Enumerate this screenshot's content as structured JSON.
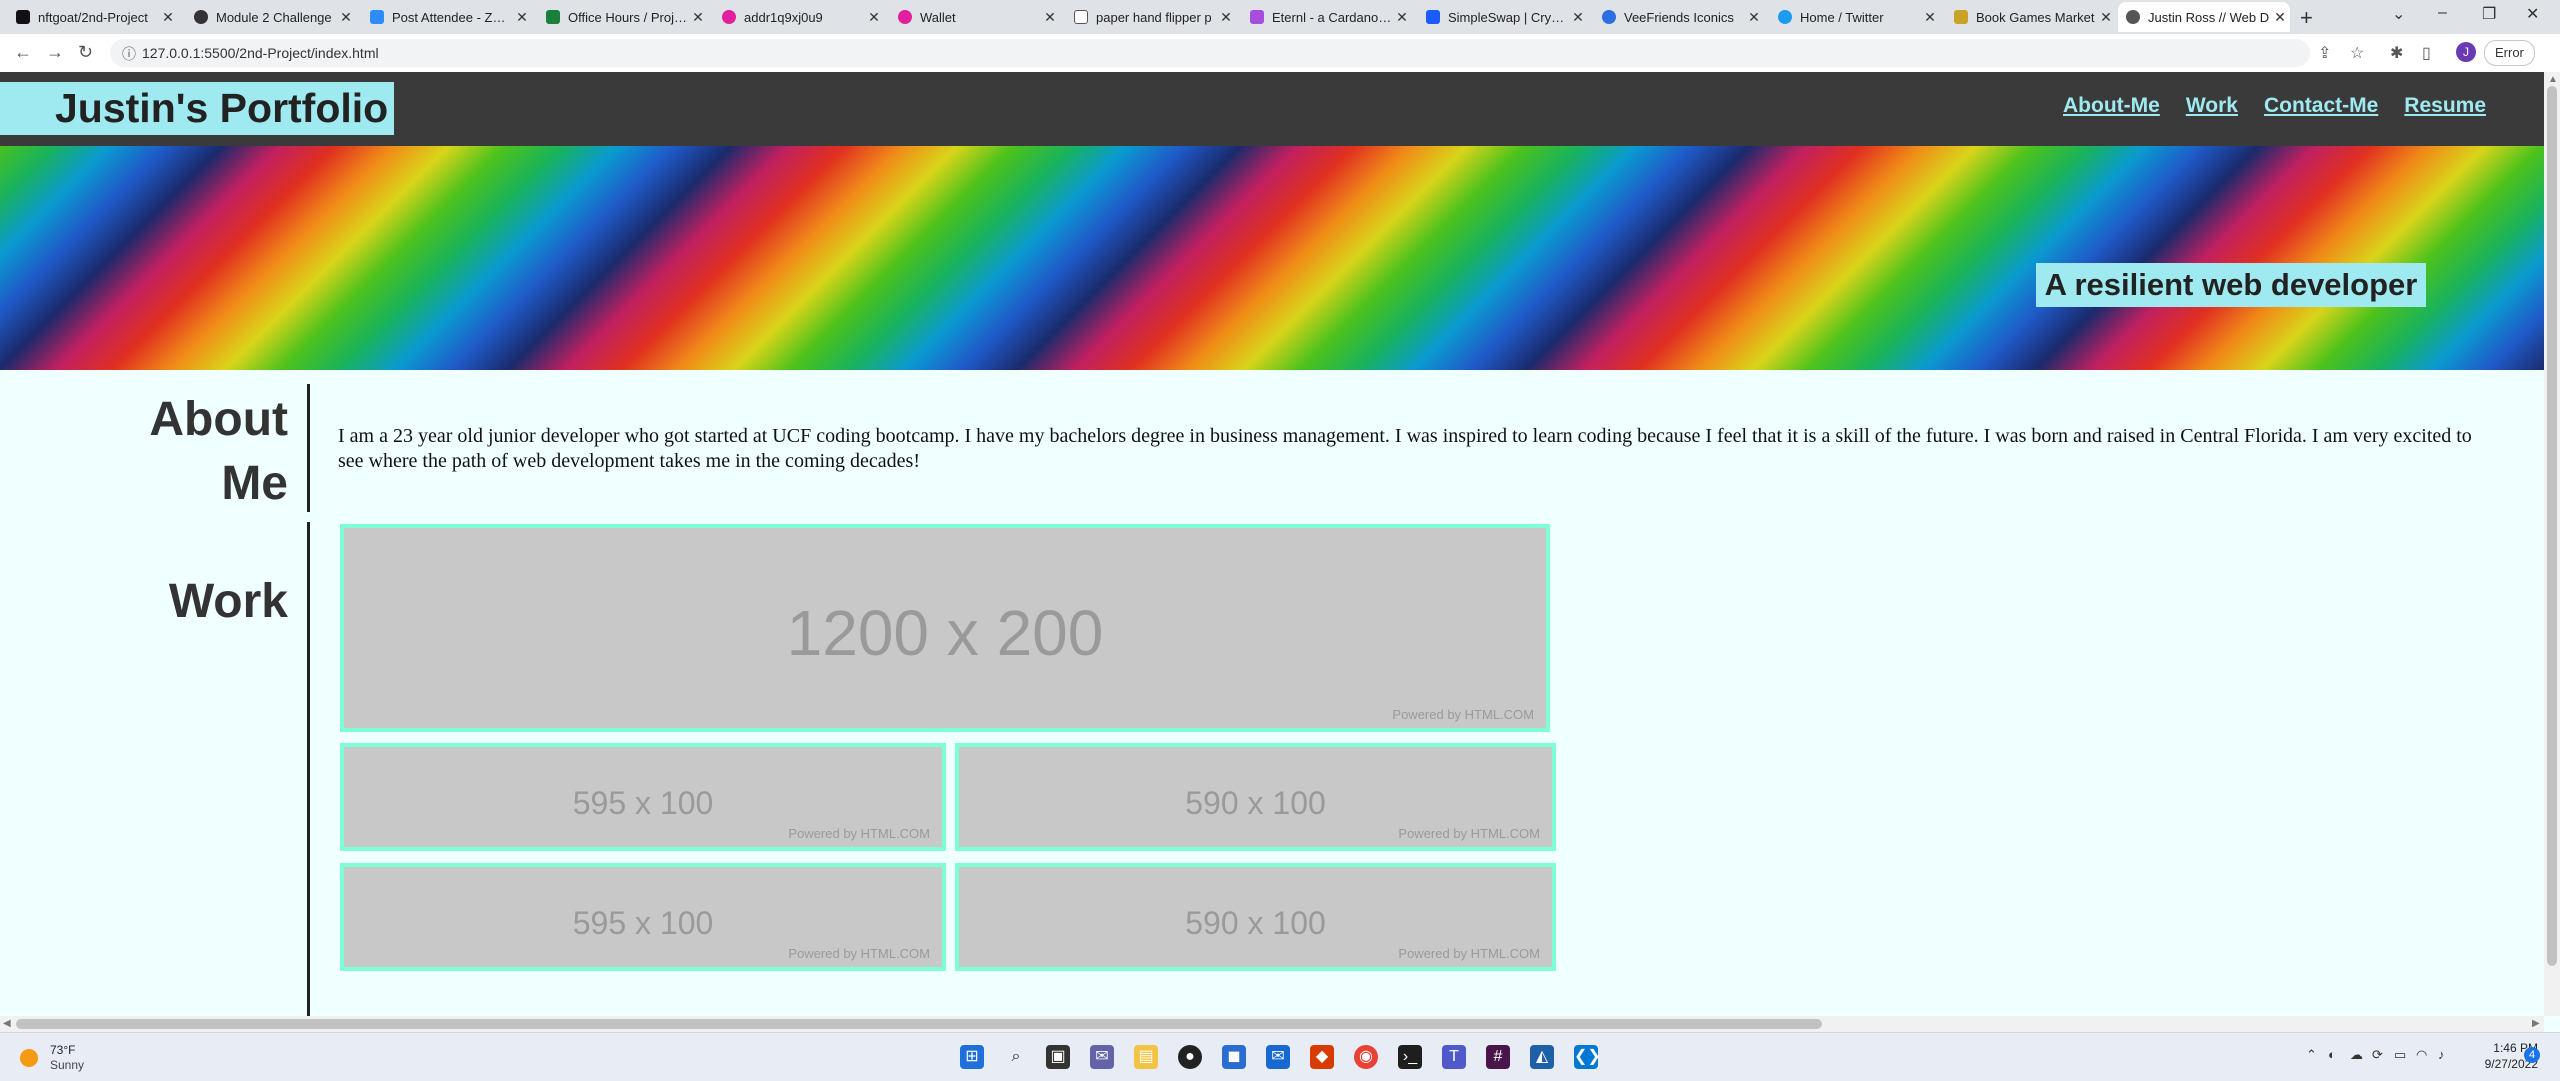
{
  "browser": {
    "tabs": [
      {
        "label": "nftgoat/2nd-Project",
        "favicon_color": "#111111"
      },
      {
        "label": "Module 2 Challenge",
        "favicon_color": "#333333"
      },
      {
        "label": "Post Attendee - Zoom",
        "favicon_color": "#2d8cff"
      },
      {
        "label": "Office Hours / Project",
        "favicon_color": "#188038"
      },
      {
        "label": "addr1q9xj0u9",
        "favicon_color": "#e0209f"
      },
      {
        "label": "Wallet",
        "favicon_color": "#e0209f"
      },
      {
        "label": "paper hand flipper p",
        "favicon_color": "#ffffff"
      },
      {
        "label": "Eternl - a Cardano co",
        "favicon_color": "#a64de0"
      },
      {
        "label": "SimpleSwap | Crypto",
        "favicon_color": "#1a5cff"
      },
      {
        "label": "VeeFriends Iconics",
        "favicon_color": "#2c6fe0"
      },
      {
        "label": "Home / Twitter",
        "favicon_color": "#1d9bf0"
      },
      {
        "label": "Book Games Market",
        "favicon_color": "#c9a227"
      },
      {
        "label": "Justin Ross // Web D",
        "favicon_color": "#555555",
        "active": true
      }
    ],
    "new_tab": "+",
    "window_controls": [
      "⌄",
      "–",
      "❐",
      "✕"
    ],
    "url": "127.0.0.1:5500/2nd-Project/index.html",
    "profile_initial": "J",
    "error_label": "Error"
  },
  "site": {
    "brand": "Justin's Portfolio",
    "nav": [
      "About-Me",
      "Work",
      "Contact-Me",
      "Resume"
    ],
    "tagline": "A resilient web developer",
    "about": {
      "title_line1": "About",
      "title_line2": "Me",
      "text": "I am a 23 year old junior developer who got started at UCF coding bootcamp. I have my bachelors degree in business management. I was inspired to learn coding because I feel that it is a skill of the future. I was born and raised in Central Florida. I am very excited to see where the path of web development takes me in the coming decades!"
    },
    "work": {
      "title": "Work",
      "placeholders": [
        {
          "dims": "1200 x 200",
          "powered": "Powered by HTML.COM"
        },
        {
          "dims": "595 x 100",
          "powered": "Powered by HTML.COM"
        },
        {
          "dims": "590 x 100",
          "powered": "Powered by HTML.COM"
        },
        {
          "dims": "595 x 100",
          "powered": "Powered by HTML.COM"
        },
        {
          "dims": "590 x 100",
          "powered": "Powered by HTML.COM"
        }
      ]
    },
    "accent_color": "#9feaf0",
    "header_color": "#3a3a3a",
    "placeholder_border_color": "#7fffd4"
  },
  "taskbar": {
    "weather_temp": "73°F",
    "weather_desc": "Sunny",
    "time": "1:46 PM",
    "date": "9/27/2022",
    "notifications": "4"
  }
}
